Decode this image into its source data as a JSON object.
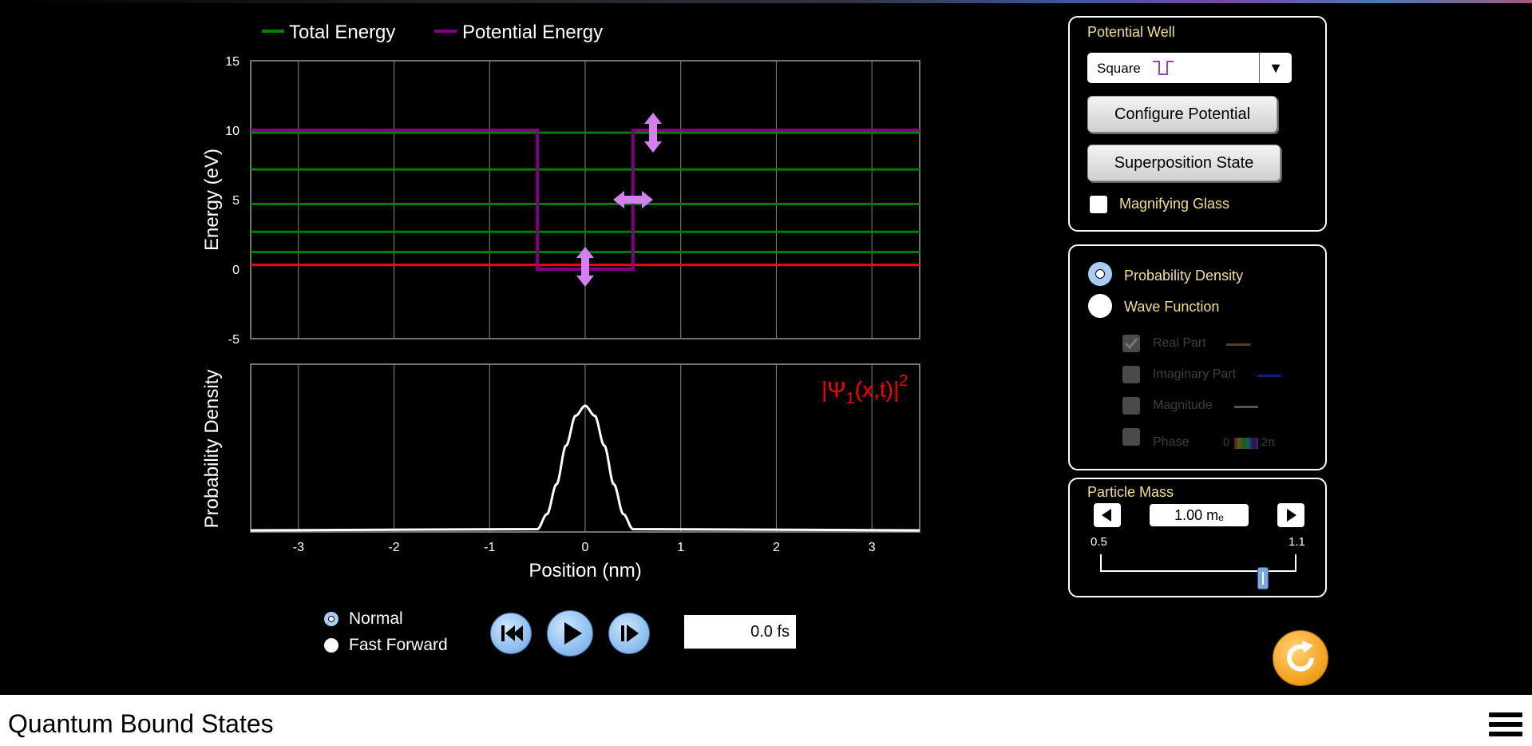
{
  "app": {
    "title": "Quantum Bound States"
  },
  "legend": {
    "total_energy": "Total Energy",
    "potential_energy": "Potential Energy"
  },
  "colors": {
    "total_energy": "#008000",
    "potential_energy": "#800080",
    "selected_level": "#ff0000",
    "panel_title": "#f0e08a",
    "handle": "#d580f0",
    "button_blue": "#8fc0ef",
    "reset": "#f5a623"
  },
  "chart_data": [
    {
      "type": "line",
      "ylabel": "Energy (eV)",
      "ylim": [
        -5,
        15
      ],
      "xlim": [
        -3.5,
        3.5
      ],
      "yticks": [
        "15",
        "10",
        "5",
        "0",
        "-5"
      ],
      "grid": true,
      "potential": {
        "name": "Potential Energy",
        "x": [
          -3.5,
          -0.5,
          -0.5,
          0.5,
          0.5,
          3.5
        ],
        "y": [
          10,
          10,
          0,
          0,
          10,
          10
        ]
      },
      "energy_levels": [
        0.31,
        1.23,
        2.69,
        4.69,
        7.18,
        9.82
      ],
      "selected_level_index": 0
    },
    {
      "type": "line",
      "ylabel": "Probability Density",
      "xlabel": "Position (nm)",
      "xlim": [
        -3.5,
        3.5
      ],
      "xticks": [
        "-3",
        "-2",
        "-1",
        "0",
        "1",
        "2",
        "3"
      ],
      "grid": true,
      "curve": {
        "x": [
          -0.5,
          -0.4,
          -0.3,
          -0.2,
          -0.1,
          0,
          0.1,
          0.2,
          0.3,
          0.4,
          0.5
        ],
        "y": [
          0.01,
          0.13,
          0.37,
          0.68,
          0.92,
          1.0,
          0.92,
          0.68,
          0.37,
          0.13,
          0.01
        ]
      },
      "annotation": {
        "base": "|Ψ",
        "sub": "1",
        "mid": "(x,t)|",
        "sup": "2"
      }
    }
  ],
  "potential_well": {
    "title": "Potential Well",
    "selected": "Square",
    "configure_label": "Configure Potential",
    "superposition_label": "Superposition State",
    "magnifying_label": "Magnifying Glass"
  },
  "view": {
    "probability_density": "Probability Density",
    "wave_function": "Wave Function",
    "real_part": "Real Part",
    "imaginary_part": "Imaginary Part",
    "magnitude": "Magnitude",
    "phase": "Phase",
    "phase_zero": "0",
    "phase_two_pi": "2π"
  },
  "particle_mass": {
    "title": "Particle Mass",
    "value": "1.00 mₑ",
    "min_label": "0.5",
    "max_label": "1.1",
    "slider_fraction": 0.83
  },
  "playback": {
    "normal": "Normal",
    "fast_forward": "Fast Forward",
    "time": "0.0 fs"
  }
}
